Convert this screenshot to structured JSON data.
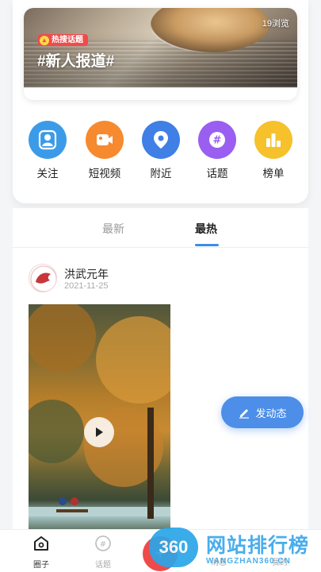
{
  "banner": {
    "hot_tag": "热搜话题",
    "title": "#新人报道#",
    "views": "19浏览"
  },
  "categories": [
    {
      "label": "关注",
      "icon": "user-follow-icon",
      "color": "#3b9be8"
    },
    {
      "label": "短视频",
      "icon": "video-camera-icon",
      "color": "#f7892f"
    },
    {
      "label": "附近",
      "icon": "location-pin-icon",
      "color": "#3f7fe6"
    },
    {
      "label": "话题",
      "icon": "hashtag-icon",
      "color": "#9a5ef0"
    },
    {
      "label": "榜单",
      "icon": "bar-chart-icon",
      "color": "#f6c12b"
    }
  ],
  "tabs": {
    "latest": "最新",
    "hot": "最热"
  },
  "post": {
    "author": "洪武元年",
    "date": "2021-11-25"
  },
  "compose_label": "发动态",
  "bottom_nav": {
    "circle": "圈子",
    "topic": "话题",
    "message": "消息",
    "mine": "我的"
  },
  "watermark": {
    "badge": "360",
    "text": "网站排行榜",
    "url": "WANGZHAN360.CN"
  }
}
